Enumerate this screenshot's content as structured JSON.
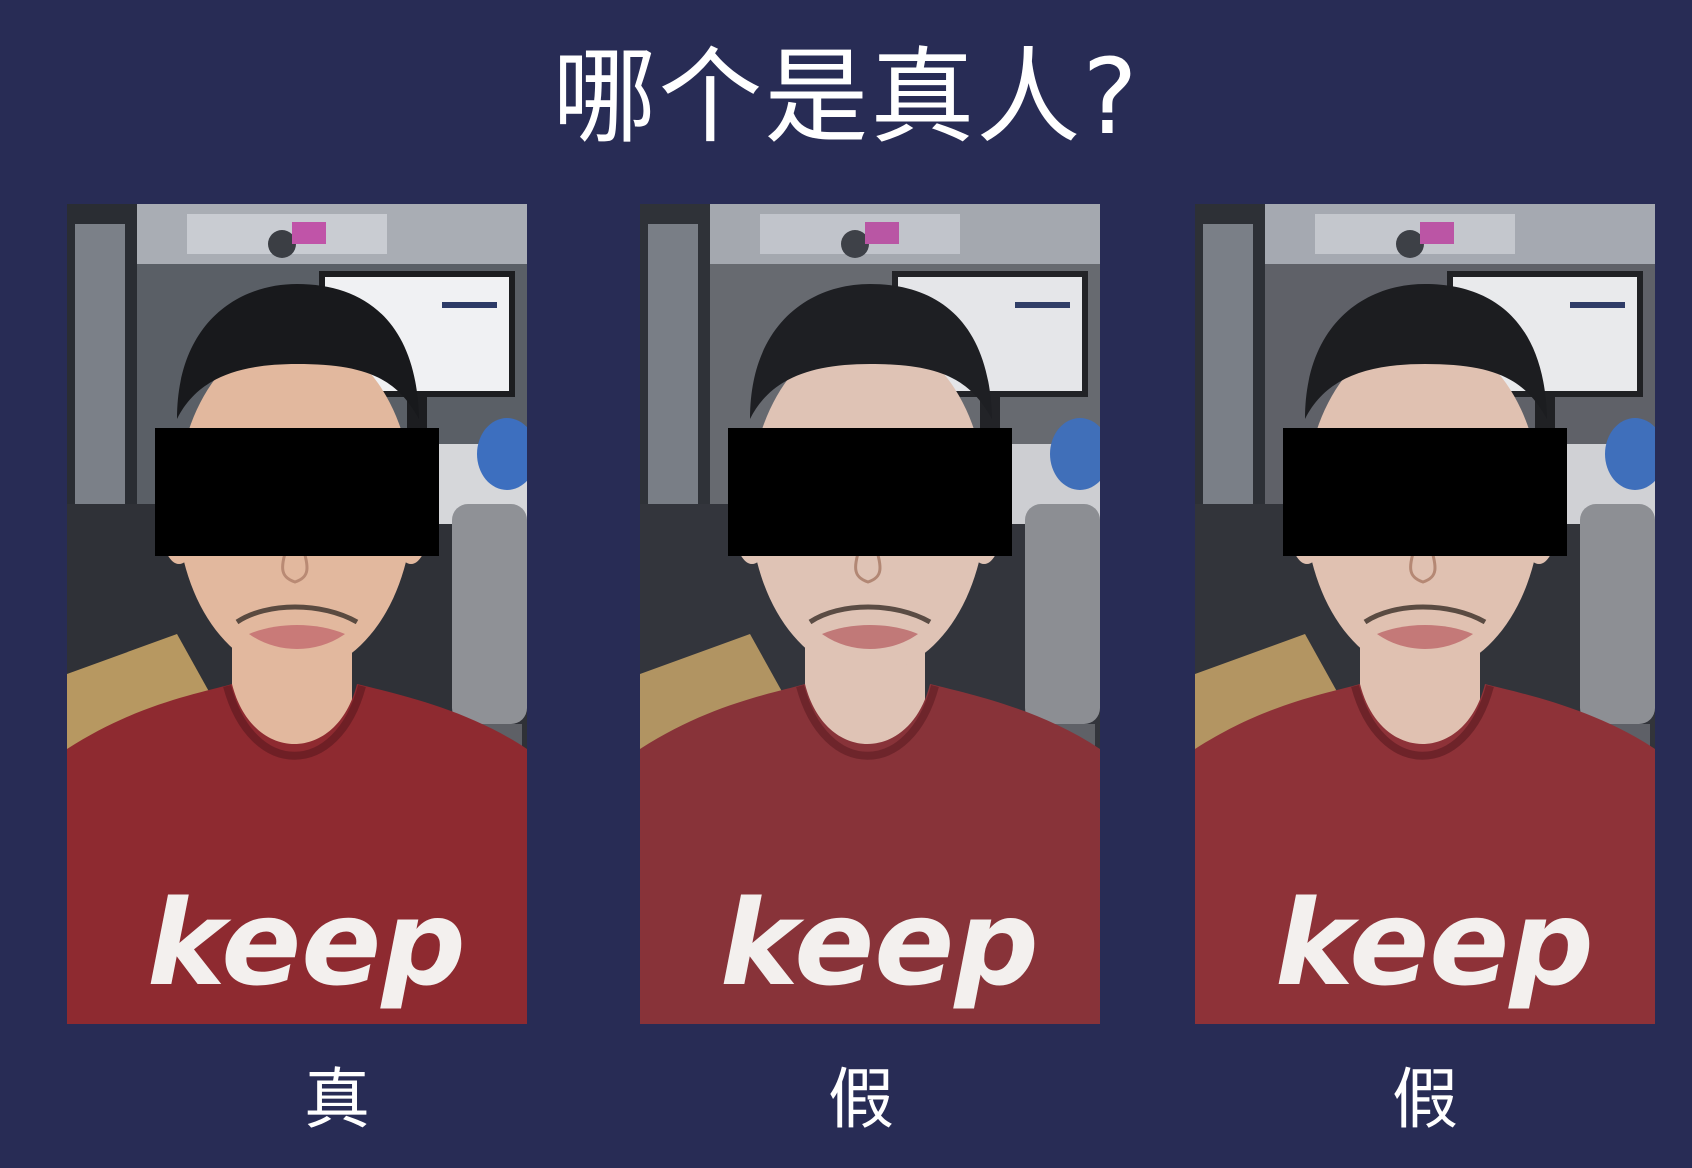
{
  "title": "哪个是真人?",
  "photos": [
    {
      "label": "真",
      "shirt_text": "keep",
      "tone": "natural",
      "colors": {
        "shirt": "#8e2a30",
        "skin": "#e2b89e",
        "bg": "#5a5f66"
      }
    },
    {
      "label": "假",
      "shirt_text": "keep",
      "tone": "washed",
      "colors": {
        "shirt": "#8b2e34",
        "skin": "#e9cbbb",
        "bg": "#676a70"
      }
    },
    {
      "label": "假",
      "shirt_text": "keep",
      "tone": "print",
      "colors": {
        "shirt": "#902f35",
        "skin": "#e7c6b4",
        "bg": "#5f6168"
      }
    }
  ],
  "colors": {
    "page_bg": "#282c55",
    "title": "#ffffff",
    "redaction": "#000000"
  }
}
